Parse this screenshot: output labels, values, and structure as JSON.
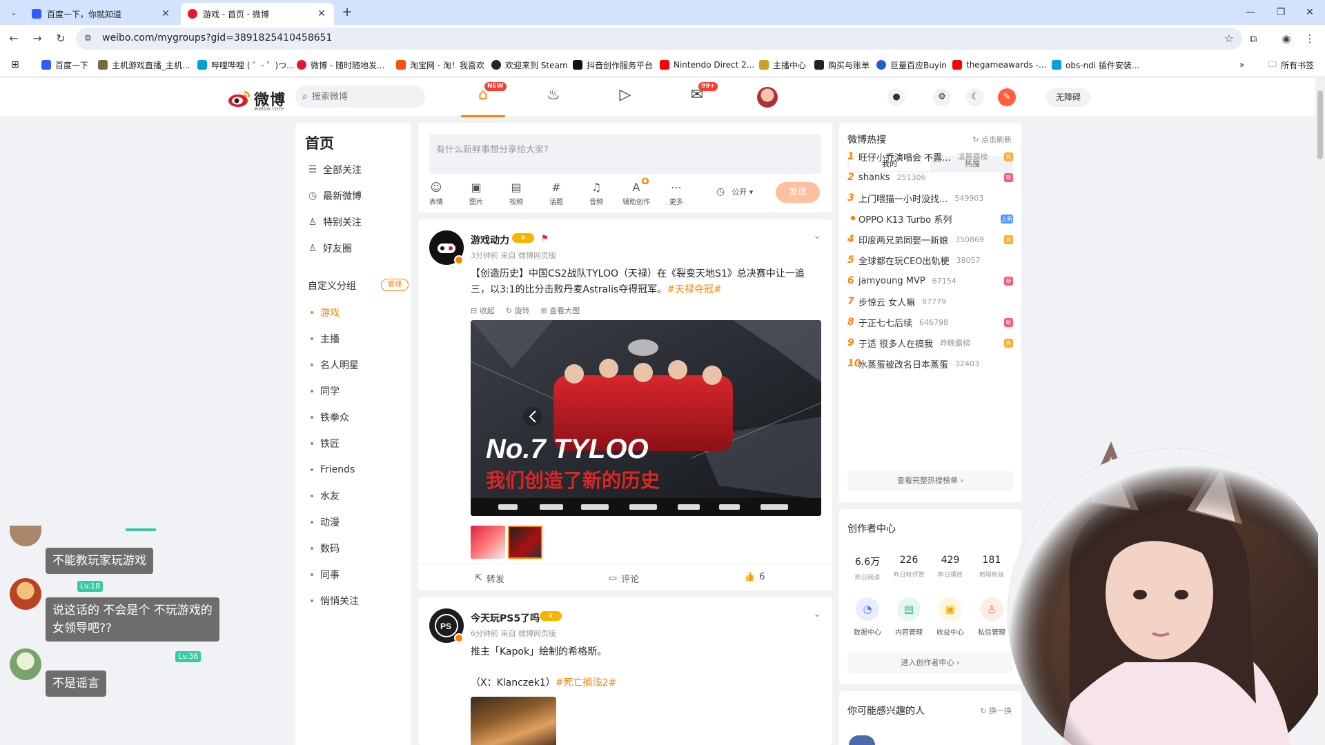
{
  "browser": {
    "tabs": [
      {
        "title": "百度一下，你就知道",
        "active": false
      },
      {
        "title": "游戏 - 首页 - 微博",
        "active": true
      }
    ],
    "url": "weibo.com/mygroups?gid=3891825410458651",
    "bookmarks": [
      "百度一下",
      "主机游戏直播_主机...",
      "哔哩哔哩 ( ゜- ゜)つ...",
      "微博 - 随时随地发...",
      "淘宝网 - 淘！我喜欢",
      "欢迎来到 Steam",
      "抖音创作服务平台",
      "Nintendo Direct 2...",
      "主播中心",
      "购买与账单",
      "巨量百应Buyin",
      "thegameawards -...",
      "obs-ndi 插件安装..."
    ],
    "all_bookmarks": "所有书签"
  },
  "weibo_header": {
    "logo_text": "微博",
    "logo_sub": "weibo.com",
    "search_placeholder": "搜索微博",
    "home_badge": "NEW",
    "msg_badge": "99+",
    "accessibility": "无障碍"
  },
  "left_nav": {
    "title": "首页",
    "items": [
      {
        "label": "全部关注",
        "icon": "list-icon"
      },
      {
        "label": "最新微博",
        "icon": "clock-icon"
      },
      {
        "label": "特别关注",
        "icon": "user-star-icon"
      },
      {
        "label": "好友圈",
        "icon": "friends-icon"
      }
    ],
    "group_header": "自定义分组",
    "manage": "管理",
    "groups": [
      "游戏",
      "主播",
      "名人明星",
      "同学",
      "铁拳众",
      "铁匠",
      "Friends",
      "水友",
      "动漫",
      "数码",
      "同事",
      "悄悄关注"
    ],
    "active_group": "游戏"
  },
  "compose": {
    "placeholder": "有什么新鲜事想分享给大家?",
    "tools": [
      "表情",
      "图片",
      "视频",
      "话题",
      "音频",
      "辅助创作",
      "更多"
    ],
    "visibility": "公开",
    "send": "发送"
  },
  "posts": [
    {
      "author": "游戏动力",
      "meta": "3分钟前  来自 微博网页版",
      "text": "【创造历史】中国CS2战队TYLOO（天禄）在《裂变天地S1》总决赛中让一追三，以3:1的比分击败丹麦Astralis夺得冠军。",
      "hashtag": "#天禄夺冠#",
      "img_tools": [
        "收起",
        "旋转",
        "查看大图"
      ],
      "image_title": "No.7 TYLOO",
      "image_caption": "我们创造了新的历史",
      "actions": {
        "repost": "转发",
        "comment": "评论",
        "like": "6"
      }
    },
    {
      "author": "今天玩PS5了吗",
      "meta": "6分钟前  来自 微博网页版",
      "text": "推主「Kapok」绘制的希格斯。",
      "credit": "（X：Klanczek1）",
      "hashtag": "#死亡搁浅2#"
    }
  ],
  "hot_search": {
    "title": "微博热搜",
    "refresh": "点击刷新",
    "tabs": [
      "我的",
      "热搜"
    ],
    "items": [
      {
        "rank": "1",
        "title": "旺仔小乔演唱会 不露...",
        "count": "凌晨霸榜",
        "tag": "热",
        "tag_color": "#ffab2d"
      },
      {
        "rank": "2",
        "title": "shanks",
        "count": "251306",
        "tag": "新",
        "tag_color": "#ff5577"
      },
      {
        "rank": "3",
        "title": "上门喂猫一小时没找...",
        "count": "549903",
        "tag": "",
        "tag_color": ""
      },
      {
        "rank": "•",
        "title": "OPPO K13 Turbo 系列",
        "count": "",
        "tag": "上新",
        "tag_color": "#4c9aff"
      },
      {
        "rank": "4",
        "title": "印度两兄弟同娶一新娘",
        "count": "350869",
        "tag": "热",
        "tag_color": "#ffab2d"
      },
      {
        "rank": "5",
        "title": "全球都在玩CEO出轨梗",
        "count": "38057",
        "tag": "",
        "tag_color": ""
      },
      {
        "rank": "6",
        "title": "jamyoung MVP",
        "count": "67154",
        "tag": "新",
        "tag_color": "#ff5577"
      },
      {
        "rank": "7",
        "title": "步惊云 女人嘛",
        "count": "87779",
        "tag": "",
        "tag_color": ""
      },
      {
        "rank": "8",
        "title": "于正七七后续",
        "count": "646798",
        "tag": "新",
        "tag_color": "#ff5577"
      },
      {
        "rank": "9",
        "title": "于适 很多人在搞我",
        "count": "昨晚霸榜",
        "tag": "热",
        "tag_color": "#ffab2d"
      },
      {
        "rank": "10",
        "title": "水蒸蛋被改名日本蒸蛋",
        "count": "32403",
        "tag": "",
        "tag_color": ""
      }
    ],
    "more": "查看完整热搜榜单"
  },
  "creator": {
    "title": "创作者中心",
    "stats": [
      {
        "value": "6.6万",
        "label": "昨日阅读"
      },
      {
        "value": "226",
        "label": "昨日转评赞"
      },
      {
        "value": "429",
        "label": "昨日播放"
      },
      {
        "value": "181",
        "label": "新增粉丝"
      }
    ],
    "apps": [
      "数据中心",
      "内容管理",
      "收益中心",
      "私信管理"
    ],
    "enter": "进入创作者中心"
  },
  "interest": {
    "title": "你可能感兴趣的人",
    "refresh": "换一换"
  },
  "chat": [
    {
      "name": "",
      "level": "",
      "msg": "不能教玩家玩游戏"
    },
    {
      "name": "",
      "level": "Lv.18",
      "msg": "说这话的 不会是个 不玩游戏的"
    },
    {
      "name": "",
      "level": "",
      "msg": "女领导吧??"
    },
    {
      "name": "",
      "level": "Lv.36",
      "msg": "不是谣言"
    }
  ]
}
